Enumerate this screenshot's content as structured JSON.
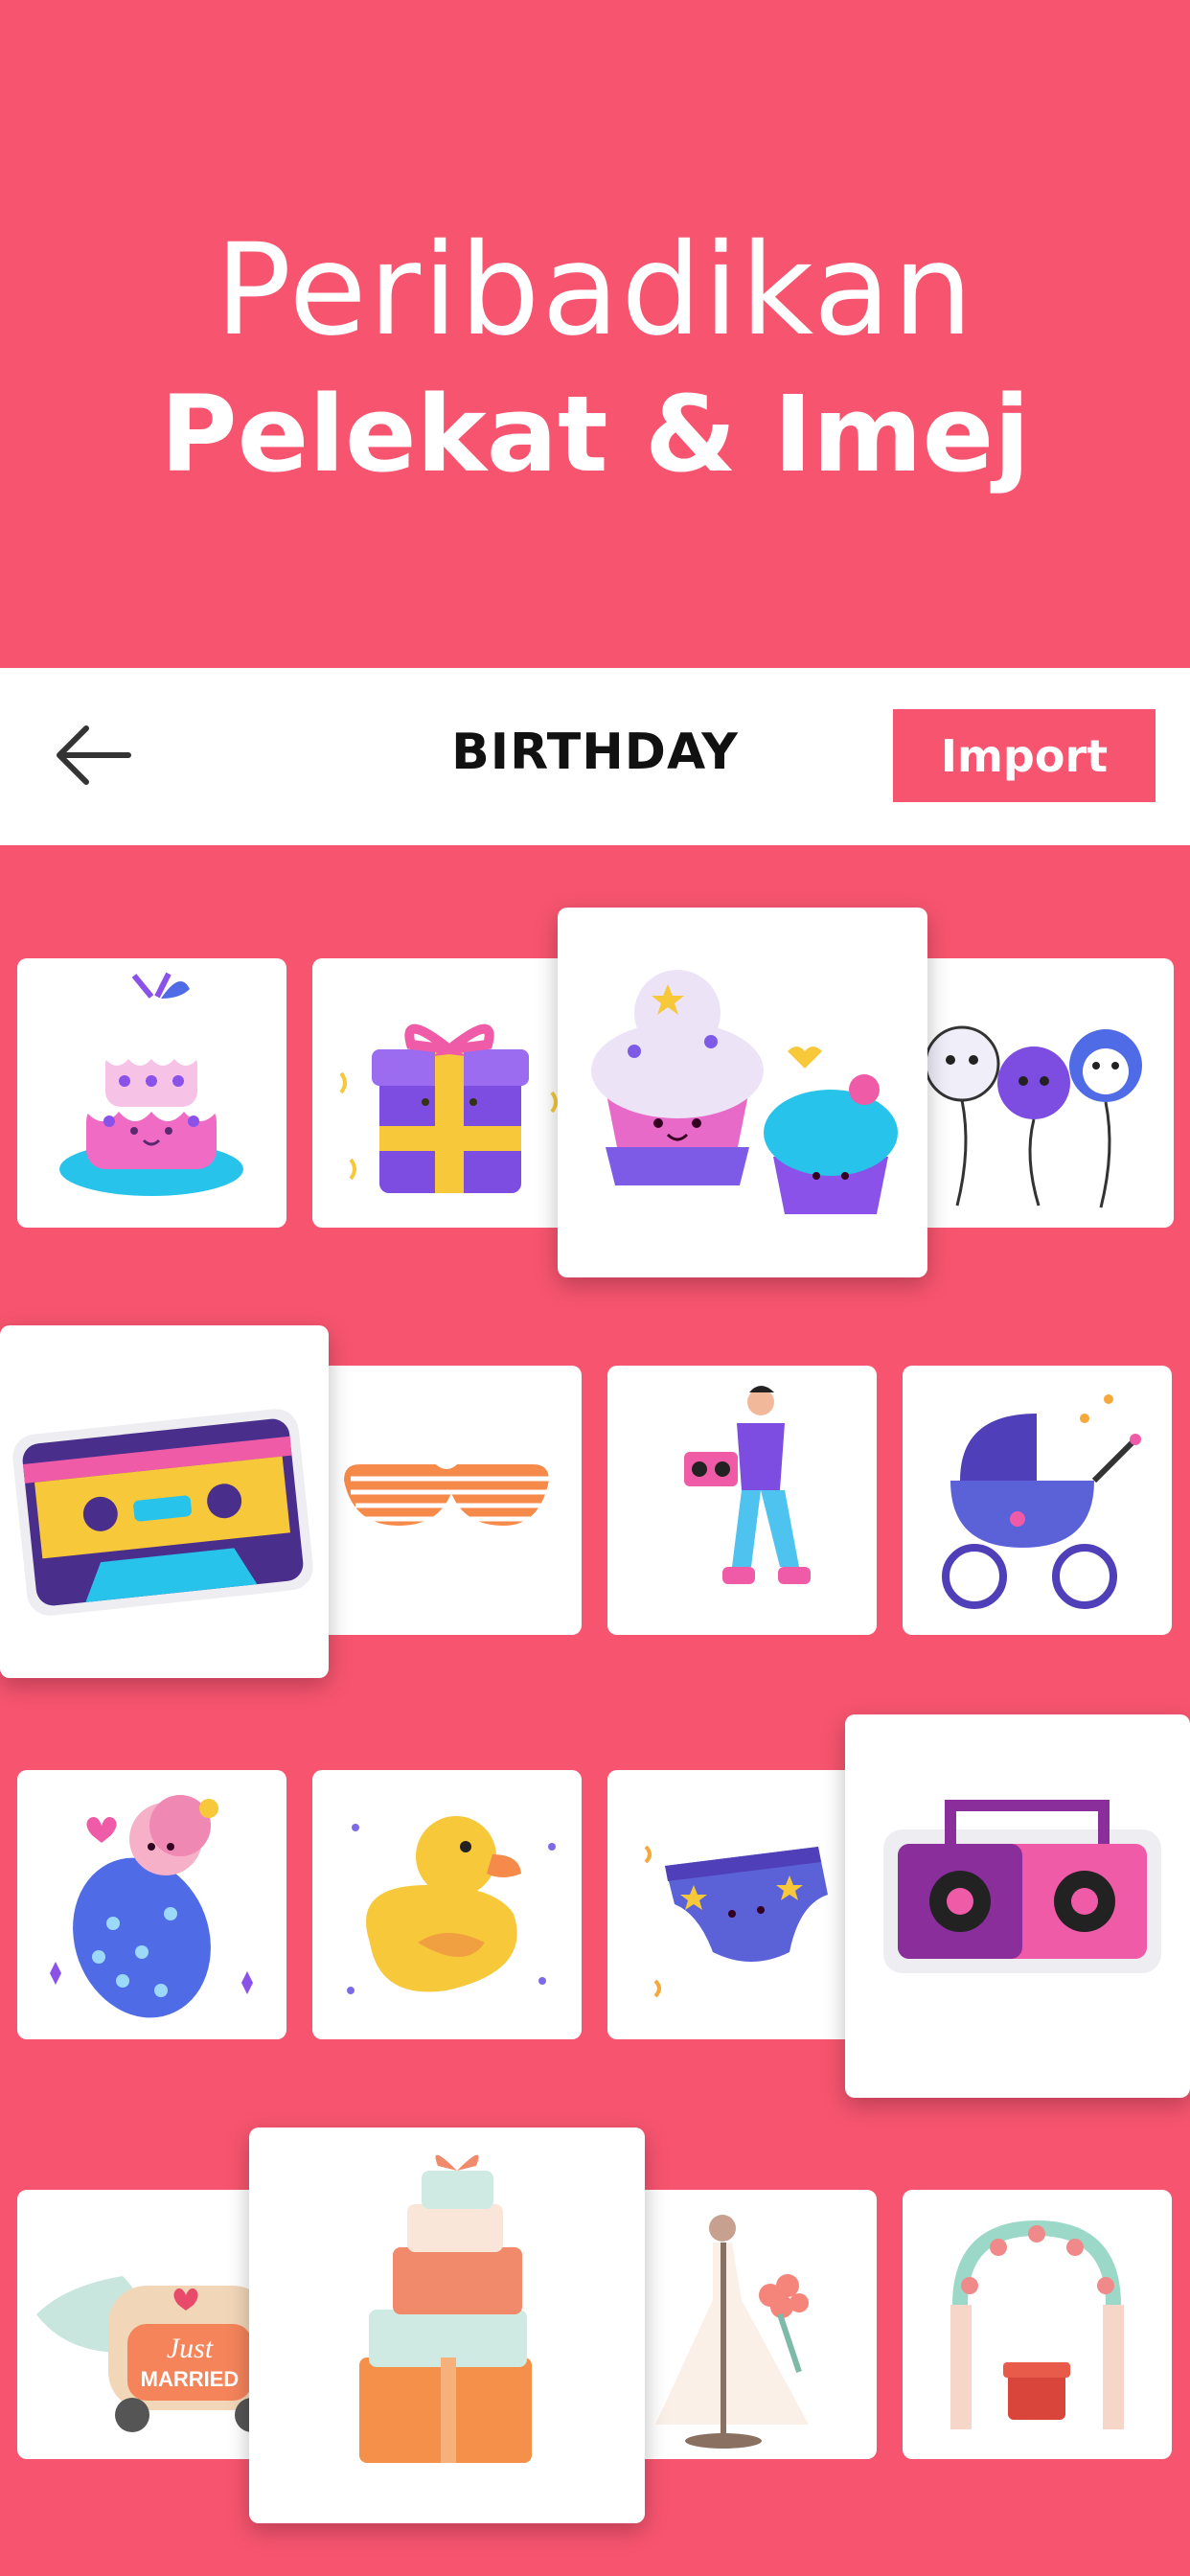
{
  "hero": {
    "line1": "Peribadikan",
    "line2": "Pelekat & Imej"
  },
  "topbar": {
    "title": "BIRTHDAY",
    "import_label": "Import",
    "back_icon": "arrow-left-icon"
  },
  "colors": {
    "accent": "#F7546F",
    "card": "#FFFFFF",
    "text": "#111111"
  },
  "stickers": [
    {
      "name": "cake-sticker"
    },
    {
      "name": "gift-box-sticker"
    },
    {
      "name": "cupcakes-sticker"
    },
    {
      "name": "animal-balloons-sticker"
    },
    {
      "name": "cassette-tape-sticker"
    },
    {
      "name": "shutter-shades-sticker"
    },
    {
      "name": "roller-skater-sticker"
    },
    {
      "name": "baby-stroller-sticker"
    },
    {
      "name": "swaddled-baby-sticker"
    },
    {
      "name": "rubber-duck-sticker"
    },
    {
      "name": "diaper-sticker"
    },
    {
      "name": "boombox-sticker"
    },
    {
      "name": "just-married-car-sticker",
      "text": "Just MARRIED"
    },
    {
      "name": "gift-stack-sticker"
    },
    {
      "name": "wedding-dress-sticker"
    },
    {
      "name": "wedding-arch-sticker"
    }
  ]
}
